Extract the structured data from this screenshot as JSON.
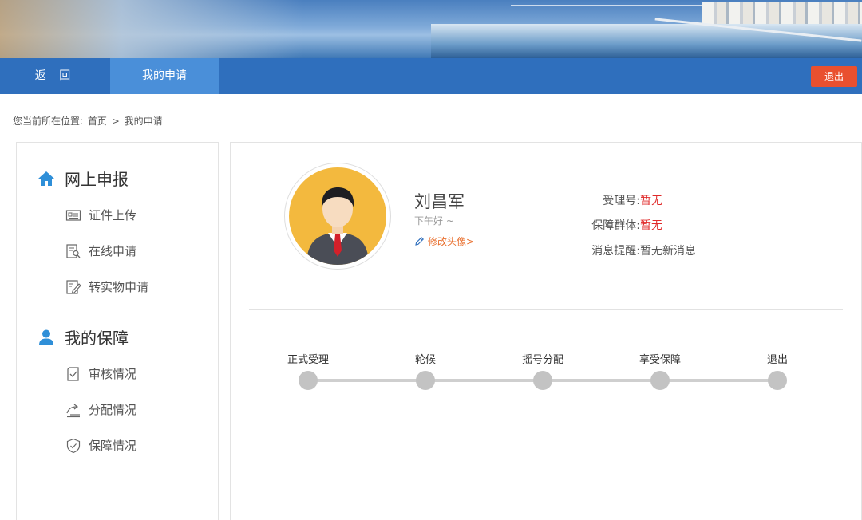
{
  "nav": {
    "back_label": "返 回",
    "my_application_label": "我的申请",
    "logout_label": "退出"
  },
  "breadcrumb": {
    "prefix": "您当前所在位置:",
    "home": "首页",
    "separator": ">",
    "current": "我的申请"
  },
  "sidebar": {
    "section_online": {
      "title": "网上申报",
      "icon": "home-icon",
      "items": [
        {
          "label": "证件上传",
          "icon": "id-card-icon"
        },
        {
          "label": "在线申请",
          "icon": "form-search-icon"
        },
        {
          "label": "转实物申请",
          "icon": "edit-document-icon"
        }
      ]
    },
    "section_guarantee": {
      "title": "我的保障",
      "icon": "user-icon",
      "items": [
        {
          "label": "审核情况",
          "icon": "review-icon"
        },
        {
          "label": "分配情况",
          "icon": "distribute-icon"
        },
        {
          "label": "保障情况",
          "icon": "shield-check-icon"
        }
      ]
    }
  },
  "profile": {
    "name": "刘昌军",
    "greeting": "下午好 ~",
    "edit_avatar_label": "修改头像>",
    "info": [
      {
        "label": "受理号:",
        "value": "暂无",
        "highlight": true
      },
      {
        "label": "保障群体:",
        "value": "暂无",
        "highlight": true
      },
      {
        "label": "消息提醒:",
        "value": "暂无新消息",
        "highlight": false
      }
    ]
  },
  "progress": {
    "steps": [
      "正式受理",
      "轮候",
      "摇号分配",
      "享受保障",
      "退出"
    ]
  },
  "colors": {
    "nav_bg": "#2f6fbd",
    "nav_active": "#4a8fd9",
    "logout_bg": "#e9502f",
    "accent_orange": "#e9702f",
    "highlight_red": "#e02a2a",
    "icon_blue": "#2f8fd8",
    "step_gray": "#c3c3c3"
  }
}
